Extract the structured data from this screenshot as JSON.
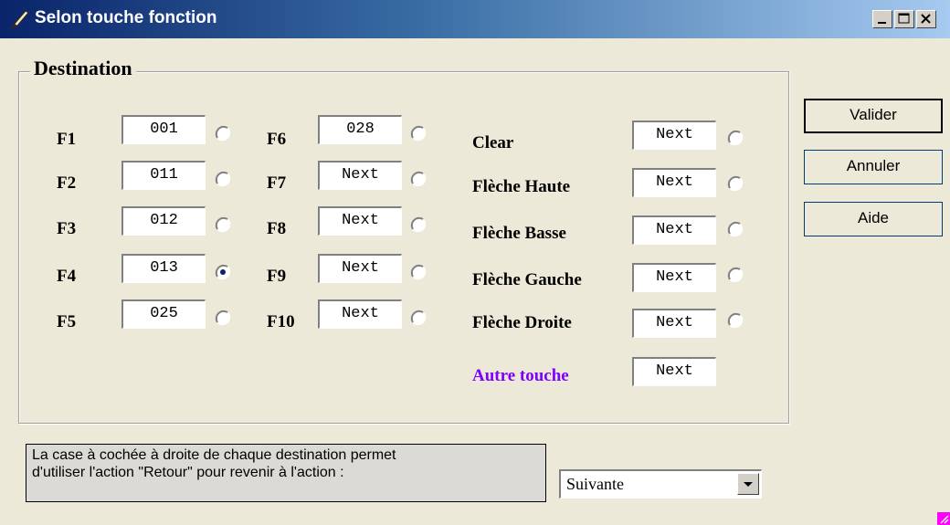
{
  "window": {
    "title": "Selon touche fonction",
    "icon": "quill-icon",
    "caption_buttons": [
      "minimize",
      "maximize",
      "close"
    ]
  },
  "destination": {
    "legend": "Destination",
    "fkeys": [
      {
        "key": "F1",
        "value": "001",
        "selected": false
      },
      {
        "key": "F2",
        "value": "011",
        "selected": false
      },
      {
        "key": "F3",
        "value": "012",
        "selected": false
      },
      {
        "key": "F4",
        "value": "013",
        "selected": true
      },
      {
        "key": "F5",
        "value": "025",
        "selected": false
      },
      {
        "key": "F6",
        "value": "028",
        "selected": false
      },
      {
        "key": "F7",
        "value": "Next",
        "selected": false
      },
      {
        "key": "F8",
        "value": "Next",
        "selected": false
      },
      {
        "key": "F9",
        "value": "Next",
        "selected": false
      },
      {
        "key": "F10",
        "value": "Next",
        "selected": false
      }
    ],
    "special_keys": [
      {
        "label": "Clear",
        "value": "Next",
        "selected": false
      },
      {
        "label": "Flèche Haute",
        "value": "Next",
        "selected": false
      },
      {
        "label": "Flèche Basse",
        "value": "Next",
        "selected": false
      },
      {
        "label": "Flèche Gauche",
        "value": "Next",
        "selected": false
      },
      {
        "label": "Flèche Droite",
        "value": "Next",
        "selected": false
      }
    ],
    "other": {
      "label": "Autre touche",
      "value": "Next",
      "color": "#8000ff"
    }
  },
  "buttons": {
    "validate": "Valider",
    "cancel": "Annuler",
    "help": "Aide"
  },
  "info": {
    "line1": "La case à cochée à droite de chaque destination permet",
    "line2": "d'utiliser l'action \"Retour\" pour revenir à l'action :"
  },
  "return_select": {
    "value": "Suivante"
  },
  "colors": {
    "title_start": "#0a246a",
    "title_end": "#a6caf0",
    "face": "#ece9d8",
    "accent_purple": "#8000ff",
    "grip": "#ff00ff"
  }
}
